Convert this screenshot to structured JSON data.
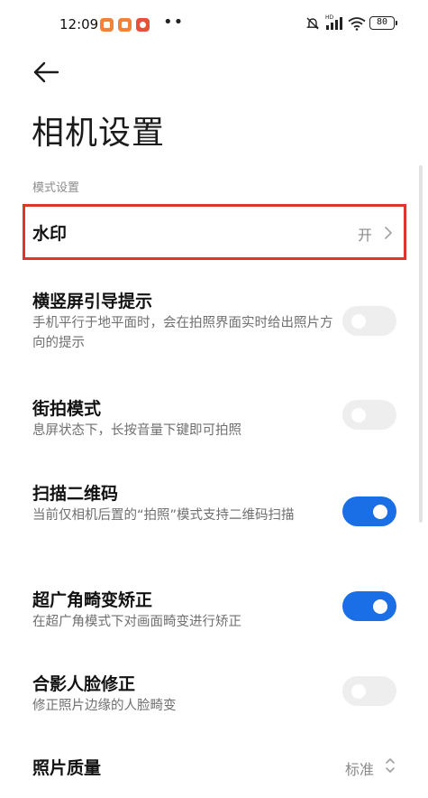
{
  "status_bar": {
    "time": "12:09",
    "more_indicator": "••",
    "battery": "80",
    "icons": [
      "app-notification-icon",
      "app-notification-icon",
      "app-notification-icon",
      "mute-icon",
      "hd-signal-icon",
      "wifi-icon",
      "battery-icon"
    ]
  },
  "header": {
    "title": "相机设置",
    "back_icon": "arrow-left-icon"
  },
  "section": {
    "label": "模式设置"
  },
  "items": [
    {
      "title": "水印",
      "value": "开",
      "type": "link"
    },
    {
      "title": "横竖屏引导提示",
      "description": "手机平行于地平面时，会在拍照界面实时给出照片方向的提示",
      "type": "toggle",
      "checked": false
    },
    {
      "title": "街拍模式",
      "description": "息屏状态下，长按音量下键即可拍照",
      "type": "toggle",
      "checked": false
    },
    {
      "title": "扫描二维码",
      "description": "当前仅相机后置的“拍照”模式支持二维码扫描",
      "type": "toggle",
      "checked": true
    },
    {
      "title": "超广角畸变矫正",
      "description": "在超广角模式下对画面畸变进行矫正",
      "type": "toggle",
      "checked": true
    },
    {
      "title": "合影人脸修正",
      "description": "修正照片边缘的人脸畸变",
      "type": "toggle",
      "checked": false
    },
    {
      "title": "照片质量",
      "value": "标准",
      "type": "select"
    }
  ],
  "colors": {
    "accent": "#1a6fe6",
    "highlight_border": "#e0342c",
    "toggle_off": "#eeeeee"
  }
}
